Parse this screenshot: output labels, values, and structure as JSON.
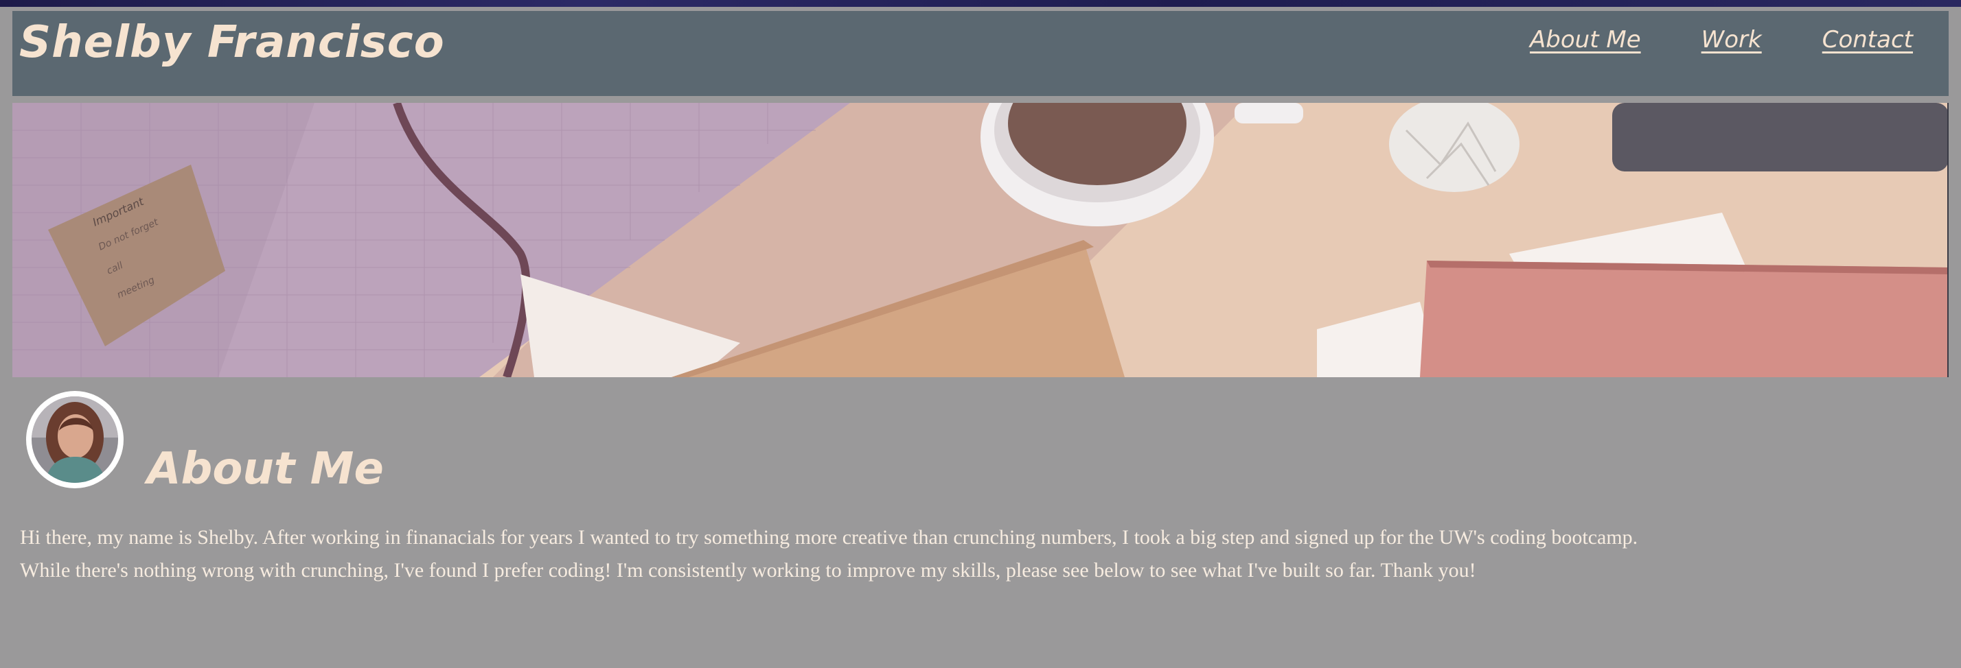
{
  "header": {
    "site_title": "Shelby Francisco",
    "nav": [
      {
        "label": "About Me"
      },
      {
        "label": "Work"
      },
      {
        "label": "Contact"
      }
    ]
  },
  "hero": {
    "note_card_text": [
      "Important",
      "Do not forget",
      "call",
      "meeting"
    ]
  },
  "about": {
    "heading": "About Me",
    "bio_lines": [
      "Hi there, my name is Shelby. After working in finanacials for years I wanted to try something more creative than crunching numbers, I took a big step and signed up for the UW's coding bootcamp.",
      "While there's nothing wrong with crunching, I've found I prefer coding! I'm consistently working to improve my skills, please see below to see what I've built so far. Thank you!"
    ]
  },
  "colors": {
    "header_bg": "#5b6871",
    "page_bg": "#9a999a",
    "accent_text": "#f6e3d0"
  }
}
